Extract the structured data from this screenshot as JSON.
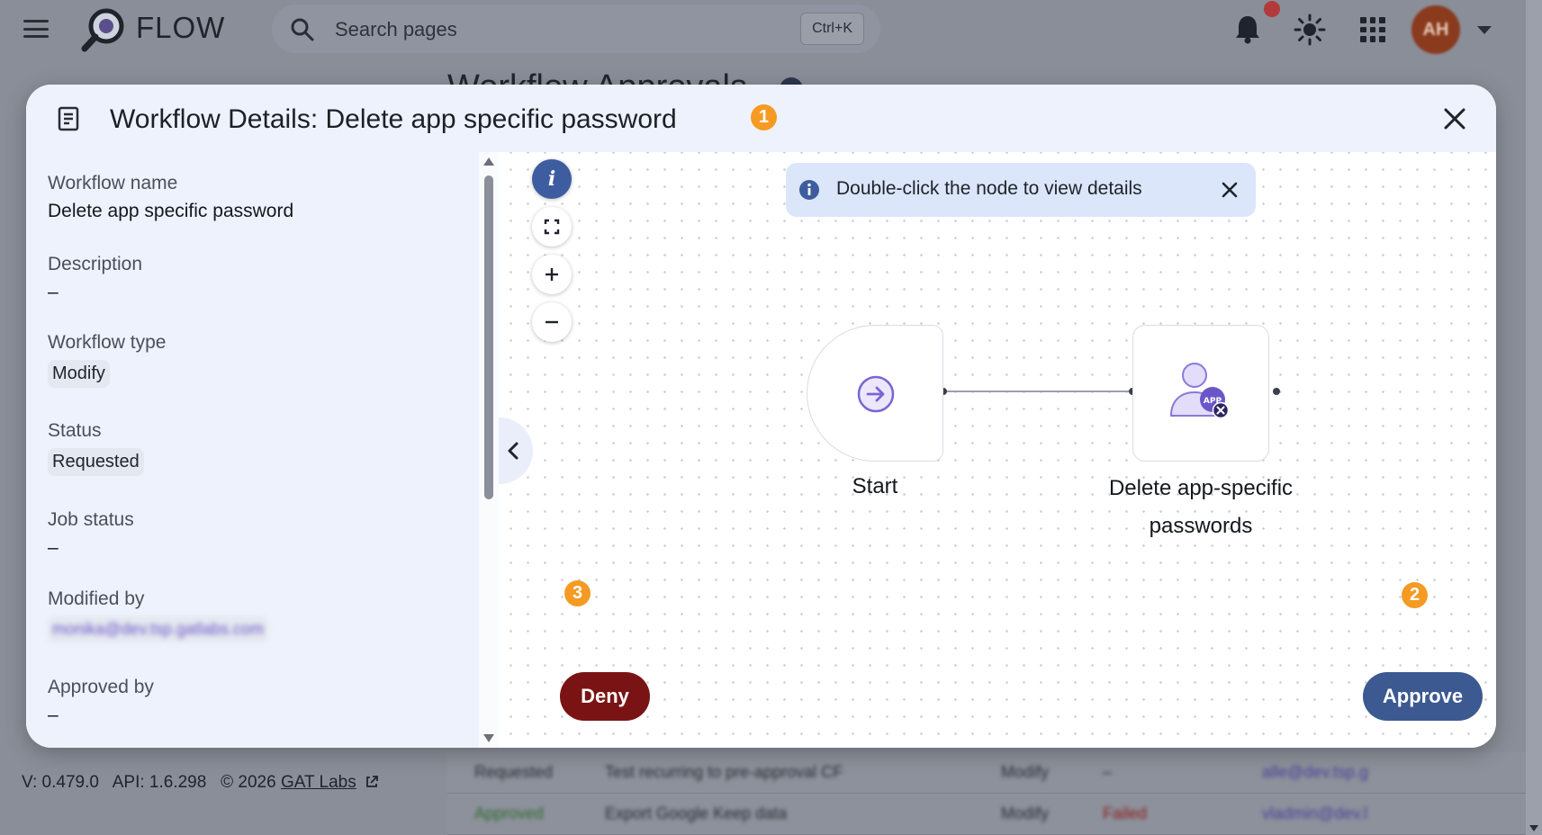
{
  "app": {
    "brand": "FLOW",
    "search": {
      "placeholder": "Search pages",
      "shortcut": "Ctrl+K"
    },
    "user_initials": "AH",
    "background_heading": "Workflow Approvals"
  },
  "footer": {
    "version": "V: 0.479.0",
    "api": "API: 1.6.298",
    "copyright": "© 2026",
    "link_label": "GAT Labs"
  },
  "background_table": {
    "rows": [
      {
        "status": "Requested",
        "name": "Test recurring to pre-approval CF",
        "type": "Modify",
        "job": "–",
        "user": "alle@dev.tsp.g",
        "status_color": "#2f323a",
        "job_color": "#2f323a"
      },
      {
        "status": "Approved",
        "name": "Export Google Keep data",
        "type": "Modify",
        "job": "Failed",
        "user": "vladmin@dev.l",
        "status_color": "#2e6b2e",
        "job_color": "#8a1c1c"
      }
    ]
  },
  "modal": {
    "title": "Workflow Details: Delete app specific password",
    "badges": {
      "title": "1",
      "approve": "2",
      "deny": "3"
    },
    "badge_color": "#f59a23",
    "details": {
      "workflow_name": {
        "label": "Workflow name",
        "value": "Delete app specific password"
      },
      "description": {
        "label": "Description",
        "value": "–"
      },
      "workflow_type": {
        "label": "Workflow type",
        "value": "Modify"
      },
      "status": {
        "label": "Status",
        "value": "Requested"
      },
      "job_status": {
        "label": "Job status",
        "value": "–"
      },
      "modified_by": {
        "label": "Modified by",
        "value": "monika@dev.tsp.gatlabs.com"
      },
      "approved_by": {
        "label": "Approved by",
        "value": "–"
      }
    },
    "canvas": {
      "controls": {
        "info": "i",
        "icons": [
          "info-icon",
          "fit-view-icon",
          "zoom-in-icon",
          "zoom-out-icon"
        ]
      },
      "hint": "Double-click the node to view details",
      "nodes": [
        {
          "label": "Start",
          "icon": "arrow-right-circle-icon"
        },
        {
          "label": "Delete app-specific passwords",
          "label_line1": "Delete app-specific",
          "label_line2": "passwords",
          "icon": "user-app-delete-icon",
          "icon_text": "APP"
        }
      ]
    },
    "actions": {
      "deny": "Deny",
      "approve": "Approve"
    },
    "colors": {
      "deny": "#7a1414",
      "approve": "#3c5991",
      "info": "#3e5da0",
      "panel": "#edf2fc"
    }
  }
}
